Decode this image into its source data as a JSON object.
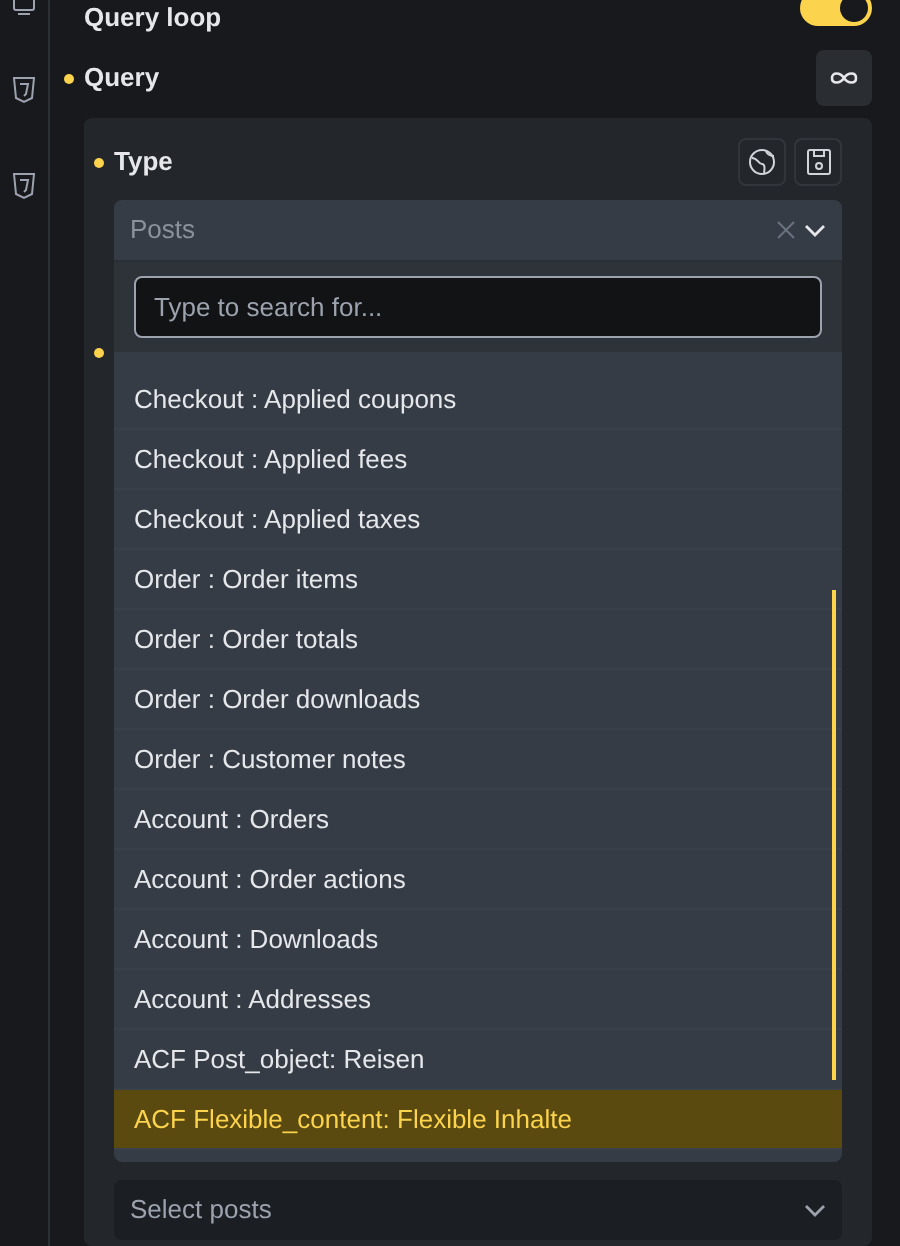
{
  "header": {
    "title": "Query loop",
    "toggle": {
      "on": true
    }
  },
  "query": {
    "label": "Query"
  },
  "type": {
    "label": "Type"
  },
  "select": {
    "value": "Posts"
  },
  "search": {
    "placeholder": "Type to search for..."
  },
  "options": [
    {
      "label": "Checkout : Applied coupons",
      "selected": false
    },
    {
      "label": "Checkout : Applied fees",
      "selected": false
    },
    {
      "label": "Checkout : Applied taxes",
      "selected": false
    },
    {
      "label": "Order : Order items",
      "selected": false
    },
    {
      "label": "Order : Order totals",
      "selected": false
    },
    {
      "label": "Order : Order downloads",
      "selected": false
    },
    {
      "label": "Order : Customer notes",
      "selected": false
    },
    {
      "label": "Account : Orders",
      "selected": false
    },
    {
      "label": "Account : Order actions",
      "selected": false
    },
    {
      "label": "Account : Downloads",
      "selected": false
    },
    {
      "label": "Account : Addresses",
      "selected": false
    },
    {
      "label": "ACF Post_object: Reisen",
      "selected": false
    },
    {
      "label": "ACF Flexible_content: Flexible Inhalte",
      "selected": true
    }
  ],
  "posts_select": {
    "placeholder": "Select posts"
  }
}
